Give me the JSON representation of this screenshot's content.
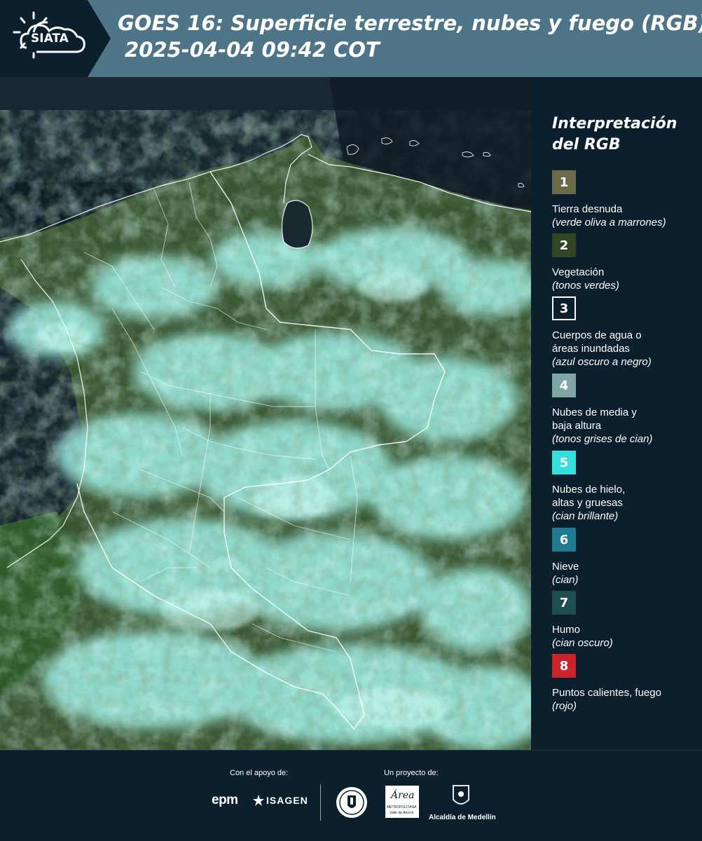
{
  "header": {
    "logo_text": "SIATA",
    "title_line1": "GOES 16: Superficie terrestre, nubes y fuego (RGB)",
    "title_line2": "2025-04-04 09:42 COT"
  },
  "legend": {
    "title_line1": "Interpretación",
    "title_line2": "del RGB",
    "items": [
      {
        "num": "1",
        "color": "#6b6a4b",
        "label": "Tierra desnuda",
        "note": "(verde oliva a marrones)"
      },
      {
        "num": "2",
        "color": "#2f4523",
        "label": "Vegetación",
        "note": "(tonos verdes)"
      },
      {
        "num": "3",
        "color": "#0c1f2c",
        "label": "Cuerpos de agua o áreas inundadas",
        "note": "(azul oscuro a negro)"
      },
      {
        "num": "4",
        "color": "#7fa6a4",
        "label": "Nubes de media y baja altura",
        "note": "(tonos grises de cian)"
      },
      {
        "num": "5",
        "color": "#35e0dc",
        "label": "Nubes de hielo, altas y gruesas",
        "note": "(cian brillante)"
      },
      {
        "num": "6",
        "color": "#1f7b8e",
        "label": "Nieve",
        "note": "(cian)"
      },
      {
        "num": "7",
        "color": "#1e4d52",
        "label": "Humo",
        "note": "(cian oscuro)"
      },
      {
        "num": "8",
        "color": "#c8242a",
        "label": "Puntos calientes, fuego",
        "note": "(rojo)"
      }
    ]
  },
  "footer": {
    "support_caption": "Con el apoyo de:",
    "project_caption": "Un proyecto de:",
    "epm_text": "epm",
    "isagen_text": "ISAGEN",
    "area_text": "Área",
    "area_sub": "METROPOLITANA",
    "area_sub2": "Valle de Aburrá",
    "alcaldia_text": "Alcaldía de Medellín"
  },
  "colors": {
    "header_bg": "#4e7587",
    "panel_bg": "#0c1f2c",
    "cloud_cyan": "#9ef0e6",
    "land_green": "#35502a",
    "sea_dark": "#0e1a22"
  }
}
